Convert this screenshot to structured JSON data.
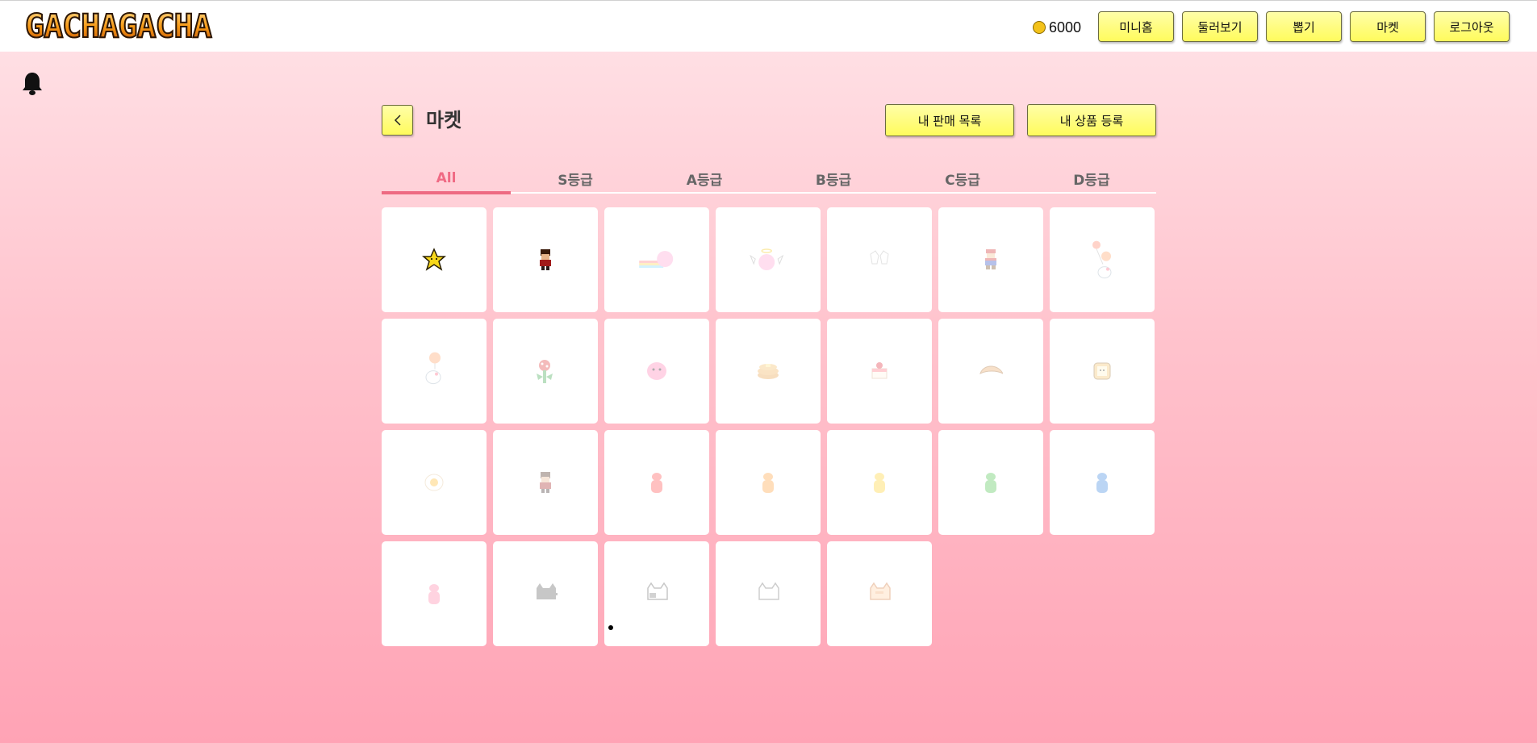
{
  "header": {
    "logo_text": "GACHAGACHA",
    "coins": "6000",
    "nav": [
      "미니홈",
      "둘러보기",
      "뽑기",
      "마켓",
      "로그아웃"
    ]
  },
  "page": {
    "title": "마켓",
    "my_sales_label": "내 판매 목록",
    "register_label": "내 상품 등록"
  },
  "tabs": [
    "All",
    "S등급",
    "A등급",
    "B등급",
    "C등급",
    "D등급"
  ],
  "active_tab": "All",
  "colors": {
    "accent": "#ee6a82",
    "button": "#fffb5c",
    "card": "#ffffff"
  },
  "items": [
    {
      "icon": "star-icon",
      "faded": false
    },
    {
      "icon": "pixel-boy-icon",
      "faded": false
    },
    {
      "icon": "kirby-rainbow-icon",
      "faded": true
    },
    {
      "icon": "kirby-angel-icon",
      "faded": true
    },
    {
      "icon": "white-gloves-icon",
      "faded": true
    },
    {
      "icon": "mario-icon",
      "faded": true
    },
    {
      "icon": "kitty-balloons-icon",
      "faded": true
    },
    {
      "icon": "kitty-balloon-icon",
      "faded": true
    },
    {
      "icon": "piranha-plant-icon",
      "faded": true
    },
    {
      "icon": "pink-blob-icon",
      "faded": true
    },
    {
      "icon": "pancake-icon",
      "faded": true
    },
    {
      "icon": "cake-icon",
      "faded": true
    },
    {
      "icon": "croissant-icon",
      "faded": true
    },
    {
      "icon": "toast-icon",
      "faded": true
    },
    {
      "icon": "egg-icon",
      "faded": true
    },
    {
      "icon": "pixel-boy-icon",
      "faded": true
    },
    {
      "icon": "red-gummy-icon",
      "faded": true
    },
    {
      "icon": "orange-gummy-icon",
      "faded": true
    },
    {
      "icon": "yellow-gummy-icon",
      "faded": true
    },
    {
      "icon": "green-gummy-icon",
      "faded": true
    },
    {
      "icon": "blue-gummy-icon",
      "faded": true
    },
    {
      "icon": "pink-gummy-icon",
      "faded": true
    },
    {
      "icon": "gray-cat-icon",
      "faded": true
    },
    {
      "icon": "white-gray-cat-icon",
      "faded": true
    },
    {
      "icon": "white-cat-icon",
      "faded": true
    },
    {
      "icon": "orange-cat-icon",
      "faded": true
    }
  ]
}
